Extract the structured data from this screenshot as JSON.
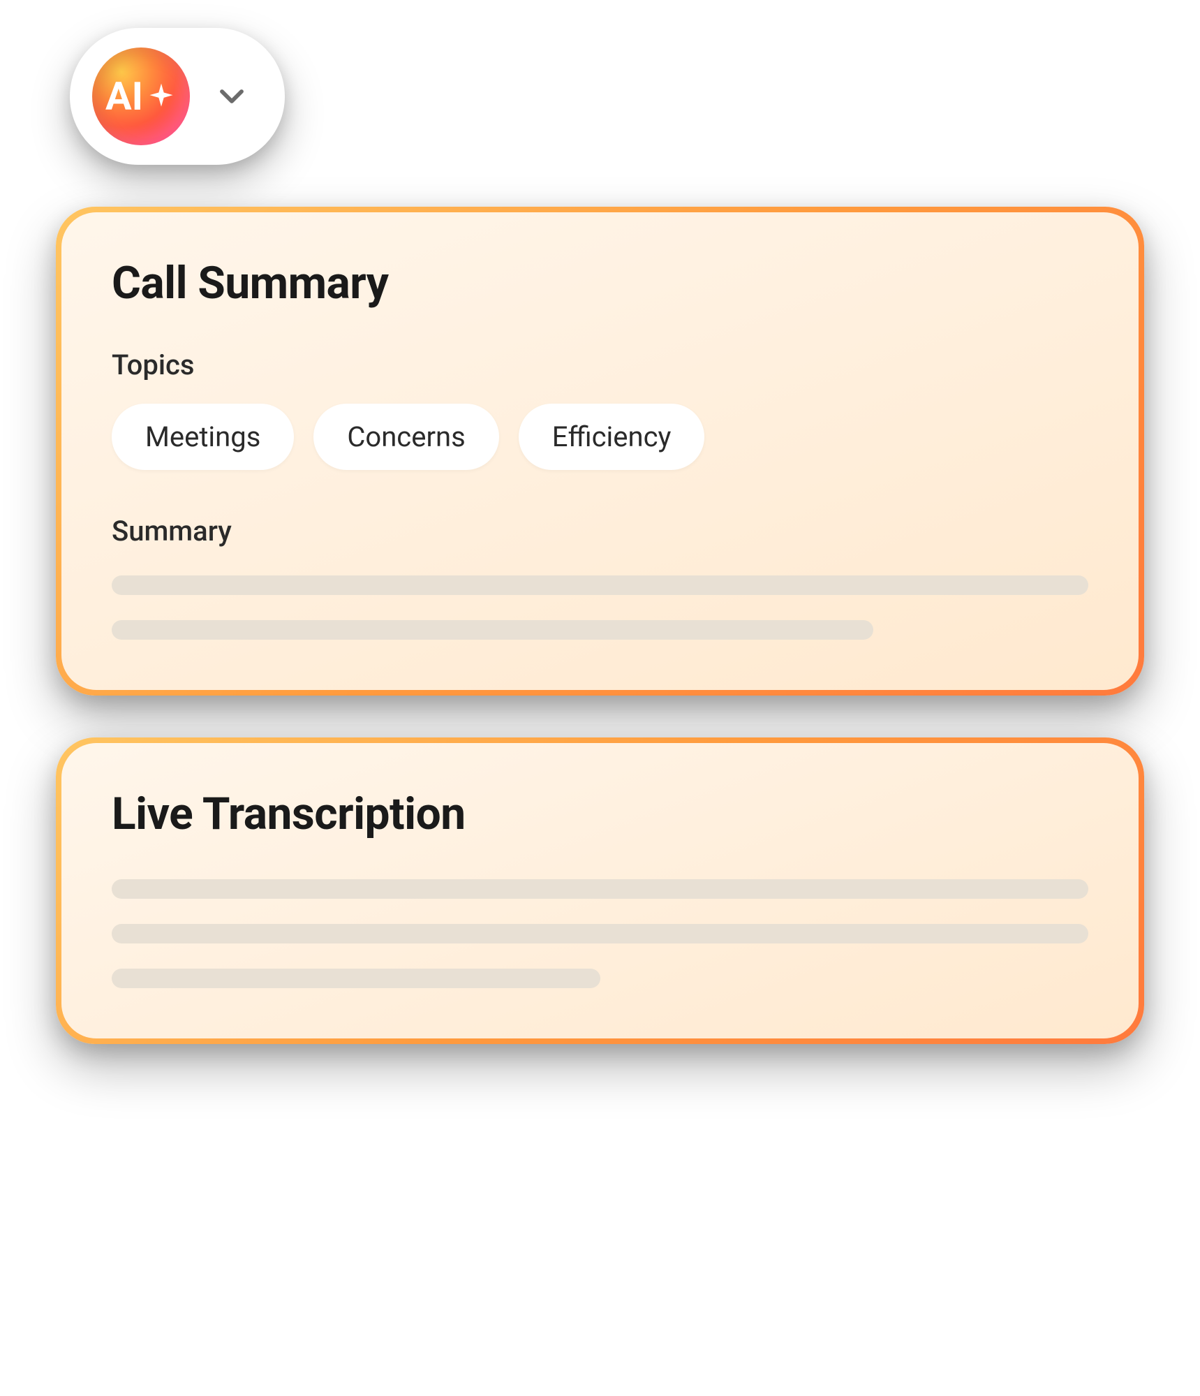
{
  "ai_toggle": {
    "label": "AI",
    "icon": "sparkle-icon",
    "dropdown_icon": "chevron-down-icon"
  },
  "call_summary": {
    "title": "Call Summary",
    "topics_label": "Topics",
    "topics": [
      "Meetings",
      "Concerns",
      "Efficiency"
    ],
    "summary_label": "Summary"
  },
  "live_transcription": {
    "title": "Live Transcription"
  },
  "colors": {
    "gradient_start": "#ffc561",
    "gradient_end": "#ff7a3d",
    "card_bg_light": "#fff6eb",
    "card_bg_dark": "#ffe9cf",
    "skeleton": "#e8e0d4",
    "text": "#1a1a1a"
  }
}
